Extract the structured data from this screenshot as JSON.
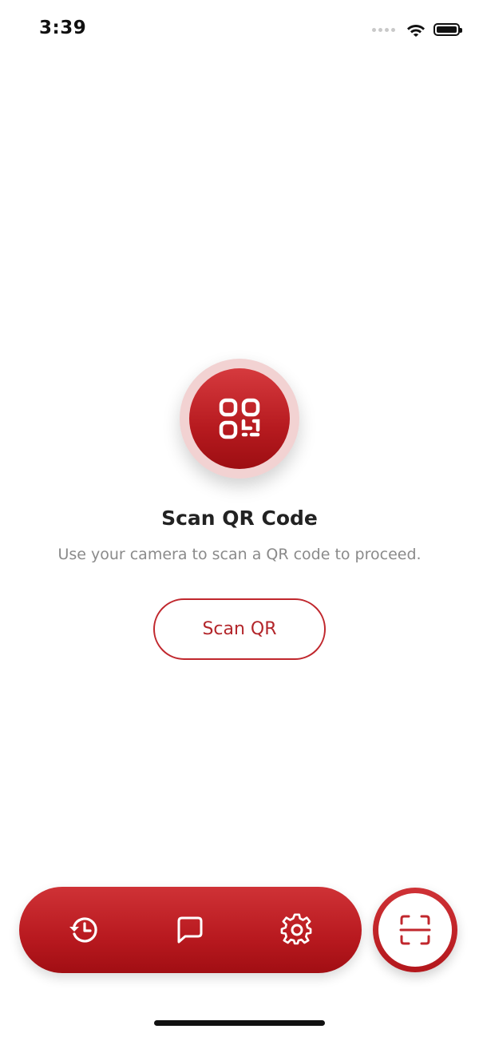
{
  "status_bar": {
    "time": "3:39"
  },
  "main": {
    "icon": "qr-code-icon",
    "title": "Scan QR Code",
    "subtitle": "Use your camera to scan a QR code to proceed.",
    "scan_button_label": "Scan QR"
  },
  "bottom_nav": {
    "items": [
      {
        "icon": "history-icon"
      },
      {
        "icon": "chat-icon"
      },
      {
        "icon": "settings-icon"
      }
    ],
    "fab_icon": "scan-frame-icon"
  },
  "colors": {
    "accent": "#c0272d",
    "accent_dark": "#9d0e12",
    "subtitle_text": "#8a8a8a"
  }
}
